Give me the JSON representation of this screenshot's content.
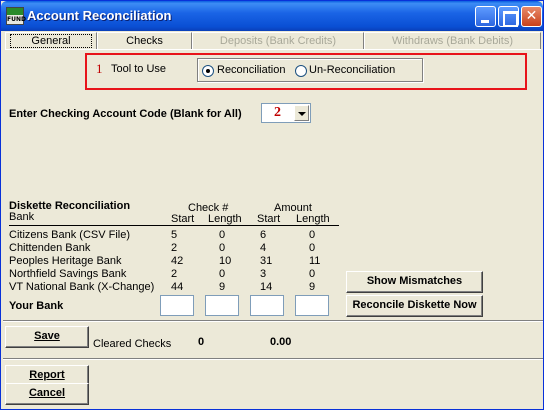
{
  "window": {
    "title": "Account Reconciliation",
    "icon_label": "FUND",
    "controls": [
      "minimize-icon",
      "maximize-icon",
      "close-icon"
    ]
  },
  "tabs": [
    {
      "label": "General",
      "state": "active"
    },
    {
      "label": "Checks",
      "state": "normal"
    },
    {
      "label": "Deposits (Bank Credits)",
      "state": "disabled"
    },
    {
      "label": "Withdraws (Bank Debits)",
      "state": "disabled"
    }
  ],
  "tool": {
    "marker": "1",
    "label": "Tool to Use",
    "options": [
      "Reconciliation",
      "Un-Reconciliation"
    ],
    "selected": "Reconciliation"
  },
  "account": {
    "label": "Enter Checking Account Code (Blank for All)",
    "marker": "2"
  },
  "diskette": {
    "title": "Diskette Reconciliation",
    "bank_header": "Bank",
    "check_header": "Check #",
    "amount_header": "Amount",
    "sub_headers": [
      "Start",
      "Length",
      "Start",
      "Length"
    ],
    "rows": [
      {
        "bank": "Citizens Bank (CSV File)",
        "values": [
          "5",
          "0",
          "6",
          "0"
        ]
      },
      {
        "bank": "Chittenden Bank",
        "values": [
          "2",
          "0",
          "4",
          "0"
        ]
      },
      {
        "bank": "Peoples Heritage Bank",
        "values": [
          "42",
          "10",
          "31",
          "11"
        ]
      },
      {
        "bank": "Northfield Savings Bank",
        "values": [
          "2",
          "0",
          "3",
          "0"
        ]
      },
      {
        "bank": "VT National Bank (X-Change)",
        "values": [
          "44",
          "9",
          "14",
          "9"
        ]
      }
    ],
    "your_bank_label": "Your Bank",
    "your_bank_values": [
      "",
      "",
      "",
      ""
    ]
  },
  "buttons": {
    "show_mismatches": "Show Mismatches",
    "reconcile": "Reconcile Diskette Now",
    "save": "Save",
    "report": "Report",
    "cancel": "Cancel"
  },
  "cleared": {
    "label": "Cleared Checks",
    "count": "0",
    "amount": "0.00"
  },
  "colors": {
    "titlebar": "#0a4fd4",
    "window_bg": "#ece9d8",
    "highlight_box": "#e8141a",
    "marker_red": "#c00000"
  }
}
